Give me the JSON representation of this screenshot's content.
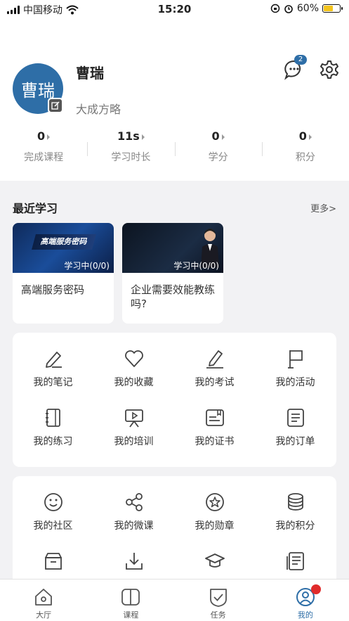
{
  "status_bar": {
    "carrier": "中国移动",
    "time": "15:20",
    "battery": "60%",
    "battery_level": 0.6
  },
  "profile": {
    "avatar_text": "曹瑞",
    "name": "曹瑞",
    "org": "大成方略",
    "message_badge": "2",
    "stats": [
      {
        "value": "0",
        "label": "完成课程"
      },
      {
        "value": "11s",
        "label": "学习时长"
      },
      {
        "value": "0",
        "label": "学分"
      },
      {
        "value": "0",
        "label": "积分"
      }
    ]
  },
  "recent": {
    "title": "最近学习",
    "more": "更多>",
    "cards": [
      {
        "title": "高端服务密码",
        "progress": "学习中(0/0)",
        "thumb_text": "高端服务密码"
      },
      {
        "title": "企业需要效能教练吗?",
        "progress": "学习中(0/0)",
        "thumb_text": ""
      }
    ]
  },
  "grid1": [
    {
      "label": "我的笔记",
      "icon": "pencil-icon"
    },
    {
      "label": "我的收藏",
      "icon": "heart-icon"
    },
    {
      "label": "我的考试",
      "icon": "edit-icon"
    },
    {
      "label": "我的活动",
      "icon": "flag-icon"
    },
    {
      "label": "我的练习",
      "icon": "notebook-icon"
    },
    {
      "label": "我的培训",
      "icon": "presentation-icon"
    },
    {
      "label": "我的证书",
      "icon": "certificate-icon"
    },
    {
      "label": "我的订单",
      "icon": "order-icon"
    }
  ],
  "grid2": [
    {
      "label": "我的社区",
      "icon": "smile-icon"
    },
    {
      "label": "我的微课",
      "icon": "share-icon"
    },
    {
      "label": "我的勋章",
      "icon": "medal-icon"
    },
    {
      "label": "我的积分",
      "icon": "coins-icon"
    },
    {
      "label": "",
      "icon": "archive-icon"
    },
    {
      "label": "",
      "icon": "download-icon"
    },
    {
      "label": "",
      "icon": "graduation-icon"
    },
    {
      "label": "",
      "icon": "document-icon"
    }
  ],
  "tabs": [
    {
      "label": "大厅",
      "icon": "home-icon"
    },
    {
      "label": "课程",
      "icon": "book-icon"
    },
    {
      "label": "任务",
      "icon": "task-icon"
    },
    {
      "label": "我的",
      "icon": "user-icon"
    }
  ],
  "colors": {
    "accent": "#2e6ea7",
    "badge_red": "#e02b2b"
  }
}
